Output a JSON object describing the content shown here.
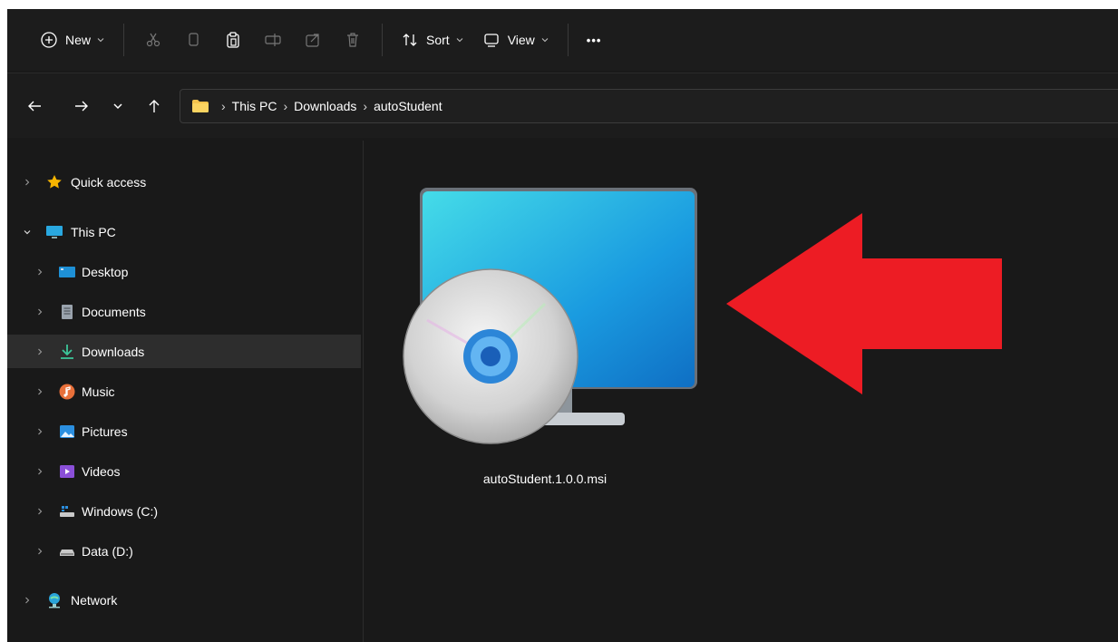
{
  "toolbar": {
    "new_label": "New",
    "sort_label": "Sort",
    "view_label": "View",
    "more_label": "•••"
  },
  "address": {
    "crumbs": [
      "This PC",
      "Downloads",
      "autoStudent"
    ]
  },
  "sidebar": {
    "items": [
      {
        "label": "Quick access",
        "icon": "star-icon"
      },
      {
        "label": "This PC",
        "icon": "pc-icon"
      },
      {
        "label": "Desktop",
        "icon": "desktop-icon"
      },
      {
        "label": "Documents",
        "icon": "documents-icon"
      },
      {
        "label": "Downloads",
        "icon": "downloads-icon"
      },
      {
        "label": "Music",
        "icon": "music-icon"
      },
      {
        "label": "Pictures",
        "icon": "pictures-icon"
      },
      {
        "label": "Videos",
        "icon": "videos-icon"
      },
      {
        "label": "Windows (C:)",
        "icon": "drive-c-icon"
      },
      {
        "label": "Data (D:)",
        "icon": "drive-d-icon"
      },
      {
        "label": "Network",
        "icon": "network-icon"
      }
    ],
    "selected": "Downloads"
  },
  "files": [
    {
      "name": "autoStudent.1.0.0.msi",
      "icon": "msi-installer-icon"
    }
  ],
  "colors": {
    "background": "#191919",
    "selection": "#2d2d2d",
    "annotation_arrow": "#ed1c24",
    "folder": "#f4c34d"
  }
}
